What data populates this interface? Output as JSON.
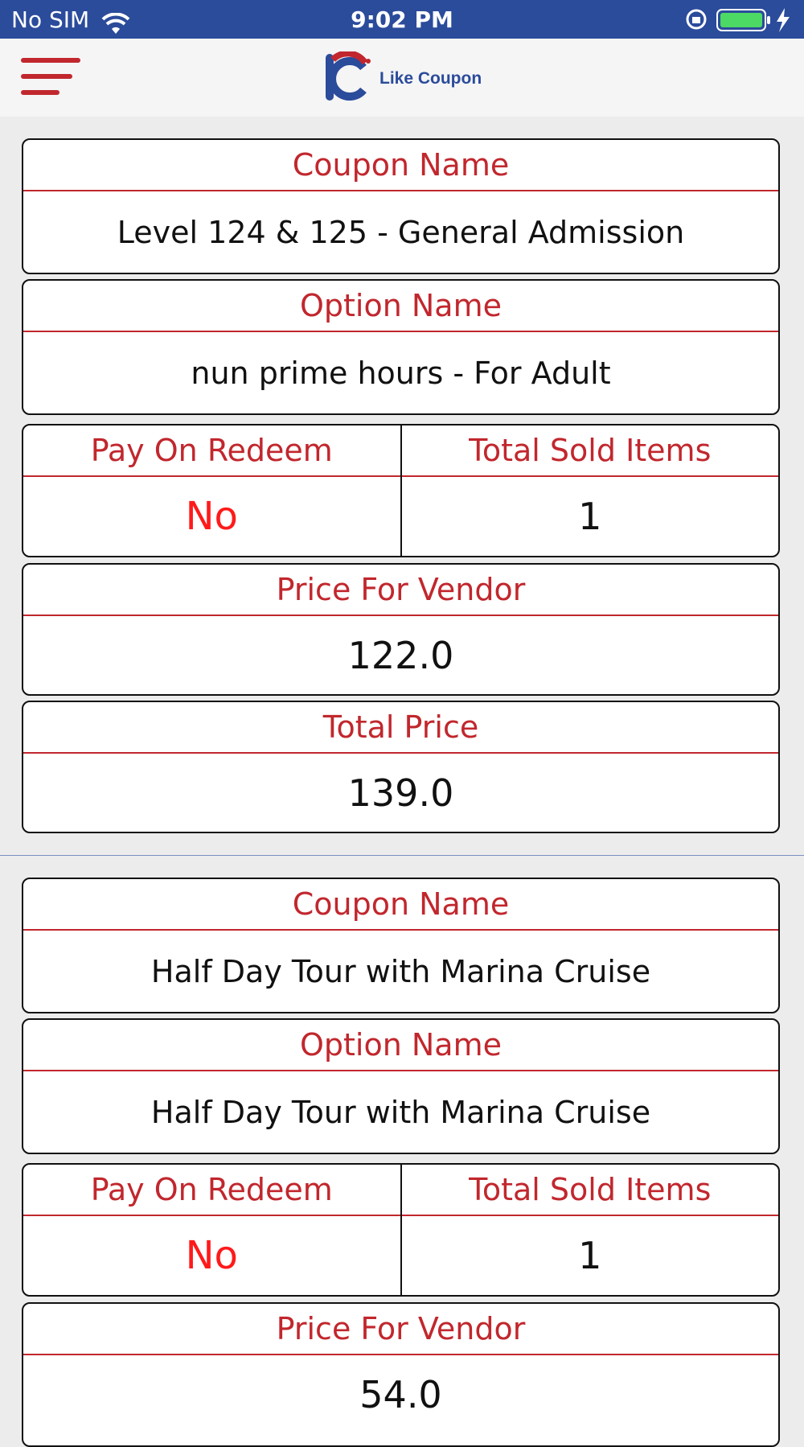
{
  "status_bar": {
    "carrier": "No SIM",
    "time": "9:02 PM"
  },
  "nav": {
    "logo_text": "Like Coupon"
  },
  "labels": {
    "coupon_name": "Coupon Name",
    "option_name": "Option Name",
    "pay_on_redeem": "Pay On Redeem",
    "total_sold_items": "Total Sold Items",
    "price_for_vendor": "Price For Vendor",
    "total_price": "Total Price"
  },
  "orders": [
    {
      "coupon_name": "Level 124 & 125 - General Admission",
      "option_name": "nun prime hours - For Adult",
      "pay_on_redeem": "No",
      "total_sold_items": "1",
      "price_for_vendor": "122.0",
      "total_price": "139.0"
    },
    {
      "coupon_name": "Half Day Tour with Marina Cruise",
      "option_name": "Half Day Tour with Marina Cruise",
      "pay_on_redeem": "No",
      "total_sold_items": "1",
      "price_for_vendor": "54.0"
    }
  ],
  "colors": {
    "status_bar": "#2b4b9b",
    "accent_red": "#c1272d",
    "value_red": "#ff1a1a"
  }
}
